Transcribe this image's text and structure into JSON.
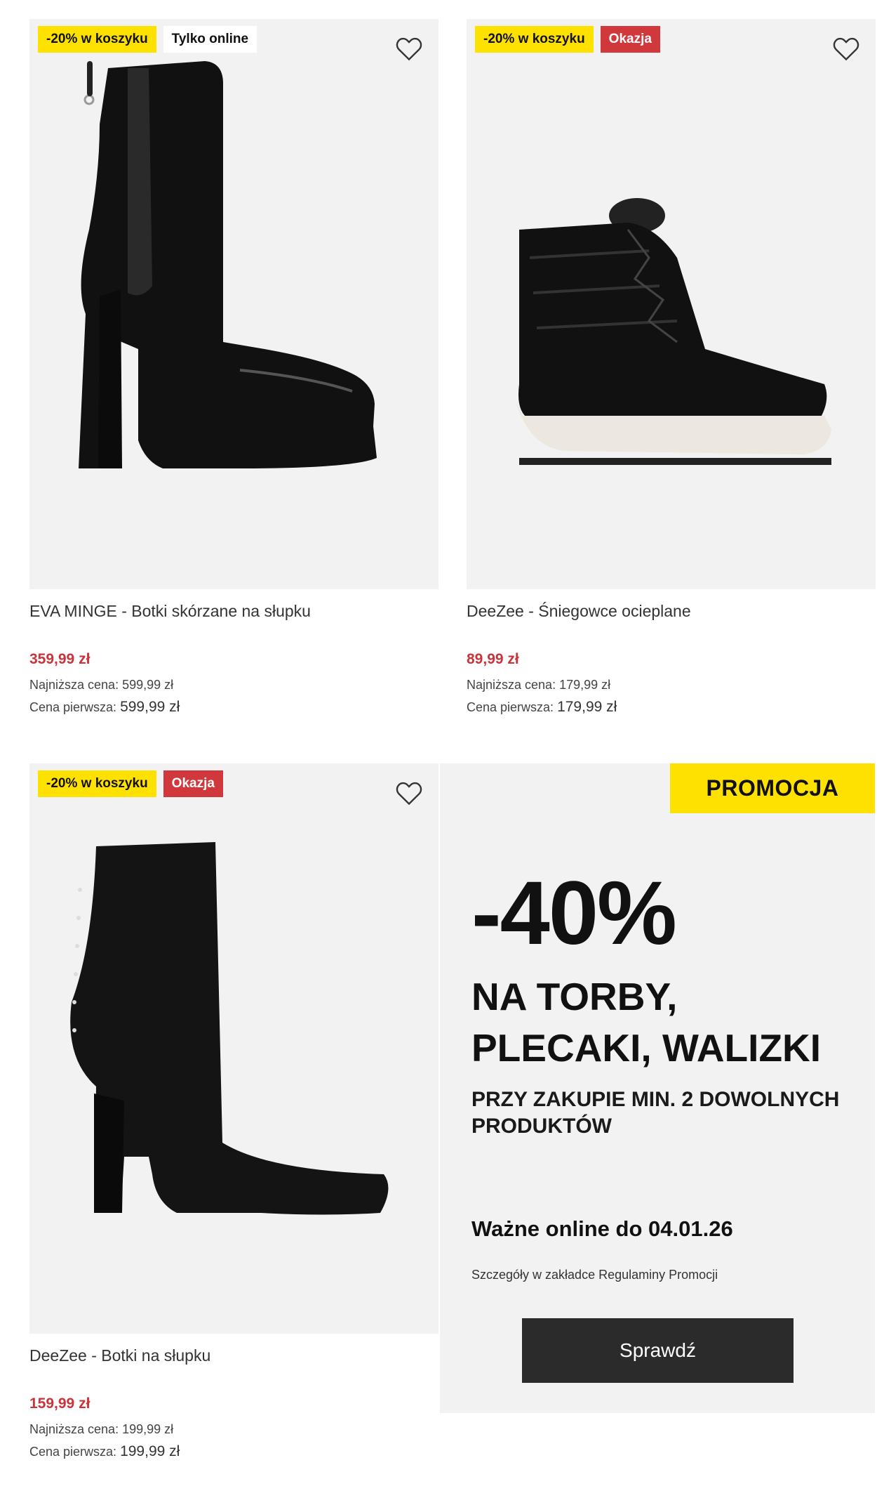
{
  "products": [
    {
      "badges": [
        "-20% w koszyku",
        "Tylko online"
      ],
      "badge_styles": [
        "yellow",
        "white"
      ],
      "title": "EVA MINGE - Botki skórzane na słupku",
      "price": "359,99 zł",
      "lowest_label": "Najniższa cena:",
      "lowest_value": "599,99 zł",
      "first_label": "Cena pierwsza:",
      "first_value": "599,99 zł",
      "image_icon": "platform-heel-chelsea-boot"
    },
    {
      "badges": [
        "-20% w koszyku",
        "Okazja"
      ],
      "badge_styles": [
        "yellow",
        "red"
      ],
      "title": "DeeZee - Śniegowce ocieplane",
      "price": "89,99 zł",
      "lowest_label": "Najniższa cena:",
      "lowest_value": "179,99 zł",
      "first_label": "Cena pierwsza:",
      "first_value": "179,99 zł",
      "image_icon": "quilted-snow-boot"
    },
    {
      "badges": [
        "-20% w koszyku",
        "Okazja"
      ],
      "badge_styles": [
        "yellow",
        "red"
      ],
      "title": "DeeZee - Botki na słupku",
      "price": "159,99 zł",
      "lowest_label": "Najniższa cena:",
      "lowest_value": "199,99 zł",
      "first_label": "Cena pierwsza:",
      "first_value": "199,99 zł",
      "image_icon": "suede-block-heel-boot"
    }
  ],
  "promo": {
    "tag": "PROMOCJA",
    "discount": "-40%",
    "line1": "NA TORBY,",
    "line2": "PLECAKI, WALIZKI",
    "subtitle": "PRZY ZAKUPIE MIN. 2 DOWOLNYCH PRODUKTÓW",
    "valid": "Ważne online do 04.01.26",
    "details": "Szczegóły w zakładce Regulaminy Promocji",
    "button": "Sprawdź"
  },
  "colors": {
    "promo_yellow": "#ffe100",
    "sale_red": "#c9343b",
    "badge_red": "#d0383c",
    "button_dark": "#2b2b2b"
  }
}
